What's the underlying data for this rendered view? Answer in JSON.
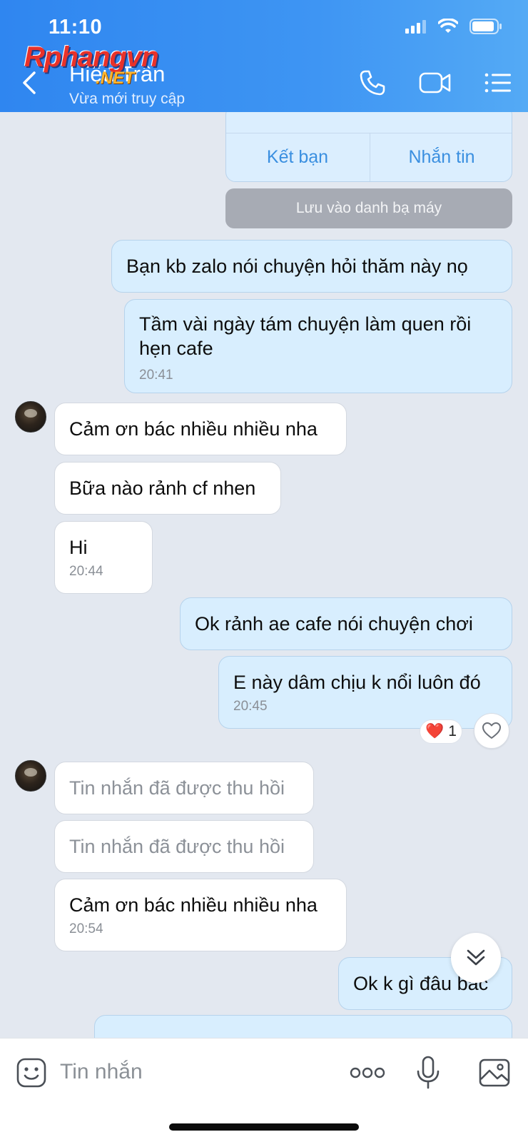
{
  "status_bar": {
    "time": "11:10"
  },
  "watermark": {
    "main": "Rphangvn",
    "sub": ".NET"
  },
  "header": {
    "contact_name": "Hiếu Trần",
    "contact_status": "Vừa mới truy cập",
    "icons": [
      "back-icon",
      "phone-icon",
      "video-call-icon",
      "menu-icon"
    ]
  },
  "contact_card": {
    "add_friend": "Kết bạn",
    "message": "Nhắn tin"
  },
  "save_contact": "Lưu vào danh bạ máy",
  "messages": [
    {
      "dir": "sent",
      "text": "Bạn kb zalo nói chuyện hỏi thăm này nọ",
      "time": ""
    },
    {
      "dir": "sent",
      "text": "Tầm vài ngày tám chuyện làm quen rồi hẹn cafe",
      "time": "20:41"
    },
    {
      "dir": "recv",
      "text": "Cảm ơn bác nhiều nhiều nha",
      "time": ""
    },
    {
      "dir": "recv",
      "text": "Bữa nào rảnh cf nhen",
      "time": ""
    },
    {
      "dir": "recv",
      "text": "Hi",
      "time": "20:44"
    },
    {
      "dir": "sent",
      "text": "Ok rảnh ae cafe nói chuyện chơi",
      "time": ""
    },
    {
      "dir": "sent",
      "text": "E này dâm chịu k nổi luôn đó",
      "time": "20:45"
    },
    {
      "dir": "recv",
      "text": "Tin nhắn đã được thu hồi",
      "time": ""
    },
    {
      "dir": "recv",
      "text": "Tin nhắn đã được thu hồi",
      "time": ""
    },
    {
      "dir": "recv",
      "text": "Cảm ơn bác nhiều nhiều nha",
      "time": "20:54"
    },
    {
      "dir": "sent",
      "text": "Ok k gì đâu bác",
      "time": ""
    }
  ],
  "reaction": {
    "emoji": "❤️",
    "count": "1"
  },
  "composer": {
    "placeholder": "Tin nhắn"
  },
  "colors": {
    "header": "#3e95f3",
    "sent_bubble": "#d8eefe",
    "recv_bubble": "#ffffff",
    "chat_bg": "#e3e8f0"
  }
}
